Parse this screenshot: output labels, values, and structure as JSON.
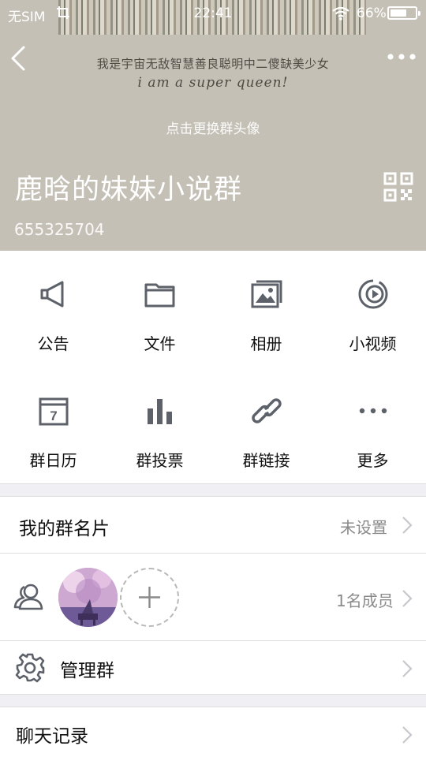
{
  "status_bar": {
    "carrier": "无SIM",
    "time": "22:41",
    "battery_percent": "66%",
    "battery_level": 0.66
  },
  "header": {
    "banner_text_cn": "我是宇宙无敌智慧善良聪明中二傻缺美少女",
    "banner_text_en": "i am a super queen!",
    "avatar_hint": "点击更换群头像",
    "group_name": "鹿晗的妹妹小说群",
    "group_id": "655325704",
    "icons": {
      "back": "chevron-left-icon",
      "more": "more-dots-icon",
      "qr": "qr-code-icon"
    }
  },
  "features": [
    {
      "label": "公告",
      "icon": "megaphone-icon"
    },
    {
      "label": "文件",
      "icon": "folder-icon"
    },
    {
      "label": "相册",
      "icon": "album-icon"
    },
    {
      "label": "小视频",
      "icon": "video-icon"
    },
    {
      "label": "群日历",
      "icon": "calendar-icon"
    },
    {
      "label": "群投票",
      "icon": "bar-chart-icon"
    },
    {
      "label": "群链接",
      "icon": "link-icon"
    },
    {
      "label": "更多",
      "icon": "more-dots-icon"
    }
  ],
  "calendar_day": "7",
  "group_card": {
    "title": "我的群名片",
    "value": "未设置"
  },
  "members": {
    "count_label": "1名成员"
  },
  "manage": {
    "title": "管理群"
  },
  "chat_history": {
    "title": "聊天记录"
  },
  "colors": {
    "header_bg": "#c4c0b6",
    "icon_gray": "#5d6169",
    "chevron": "#c7c7cc"
  }
}
